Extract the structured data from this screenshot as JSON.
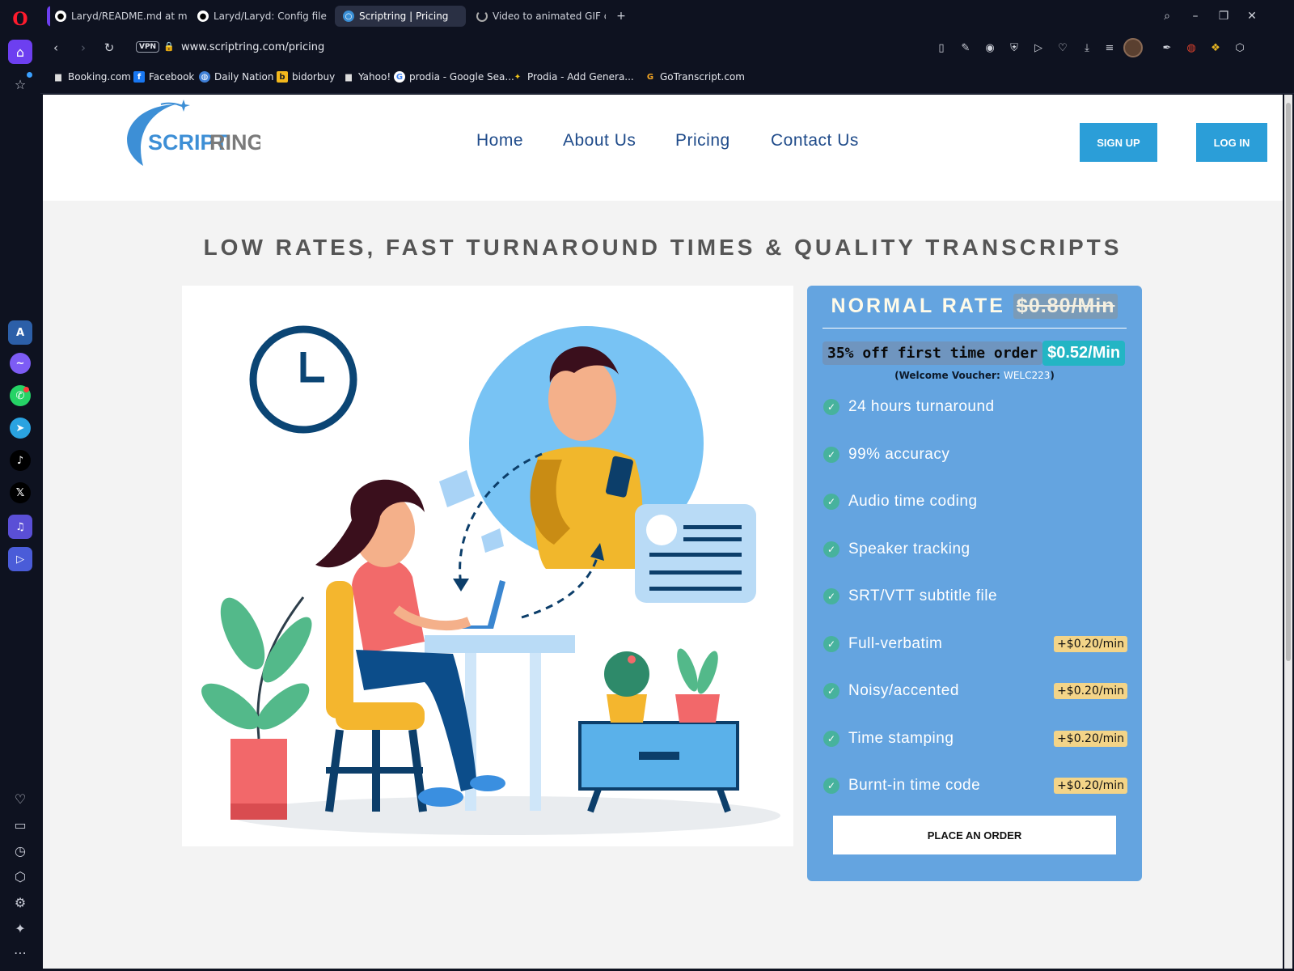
{
  "browser": {
    "tabs": [
      {
        "title": "Laryd/README.md at mai",
        "icon": "github-icon"
      },
      {
        "title": "Laryd/Laryd: Config files fo",
        "icon": "github-icon"
      },
      {
        "title": "Scriptring | Pricing",
        "icon": "scriptring-icon"
      },
      {
        "title": "Video to animated GIF con",
        "icon": "loading-icon"
      }
    ],
    "new_tab_label": "+",
    "address": {
      "vpn_label": "VPN",
      "url": "www.scriptring.com/pricing"
    },
    "bookmarks": [
      {
        "label": "Booking.com",
        "icon": "page-icon"
      },
      {
        "label": "Facebook",
        "icon": "facebook-icon"
      },
      {
        "label": "Daily Nation",
        "icon": "globe-icon"
      },
      {
        "label": "bidorbuy",
        "icon": "bidorbuy-icon"
      },
      {
        "label": "Yahoo!",
        "icon": "page-icon"
      },
      {
        "label": "prodia - Google Sea...",
        "icon": "google-icon"
      },
      {
        "label": "Prodia - Add Genera...",
        "icon": "prodia-icon"
      },
      {
        "label": "GoTranscript.com",
        "icon": "gotranscript-icon"
      }
    ]
  },
  "site": {
    "logo": {
      "text_blue": "SCRIPT",
      "text_gray": "RING"
    },
    "nav": [
      "Home",
      "About Us",
      "Pricing",
      "Contact Us"
    ],
    "signup_label": "SIGN UP",
    "login_label": "LOG IN",
    "headline": "LOW RATES, FAST TURNAROUND TIMES & QUALITY TRANSCRIPTS",
    "card": {
      "normal_rate_label": "NORMAL RATE",
      "old_price": "$0.80/Min",
      "promo_text": "35% off first time order",
      "promo_price": "$0.52/Min",
      "voucher_prefix": "(Welcome Voucher: ",
      "voucher_code": "WELC223",
      "voucher_suffix": ")",
      "features": [
        {
          "label": "24 hours turnaround",
          "addon": ""
        },
        {
          "label": "99% accuracy",
          "addon": ""
        },
        {
          "label": "Audio time coding",
          "addon": ""
        },
        {
          "label": "Speaker tracking",
          "addon": ""
        },
        {
          "label": "SRT/VTT subtitle file",
          "addon": ""
        },
        {
          "label": "Full-verbatim",
          "addon": "+$0.20/min"
        },
        {
          "label": "Noisy/accented",
          "addon": "+$0.20/min"
        },
        {
          "label": "Time stamping",
          "addon": "+$0.20/min"
        },
        {
          "label": "Burnt-in time code",
          "addon": "+$0.20/min"
        }
      ],
      "order_button": "PLACE AN ORDER"
    }
  },
  "colors": {
    "nav_text": "#1f4b8a",
    "button_blue": "#2b9ed8",
    "card_bg": "#64a4e0",
    "check_green": "#47b29d",
    "addon_bg": "#f3d488",
    "opera_accent": "#6d3ff0"
  }
}
